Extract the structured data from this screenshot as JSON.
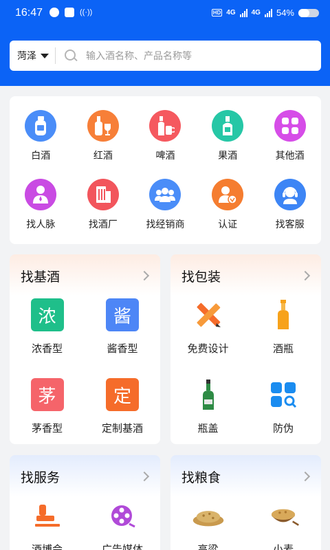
{
  "status_bar": {
    "time": "16:47",
    "network1": "4G",
    "network2": "4G",
    "battery": "54%",
    "hd": "HD"
  },
  "search": {
    "city": "菏泽",
    "placeholder": "输入酒名称、产品名称等"
  },
  "categories": [
    {
      "label": "白酒",
      "icon": "baijiu-bottle-icon",
      "color": "#4a8df8"
    },
    {
      "label": "红酒",
      "icon": "wine-bottle-glass-icon",
      "color": "#f77f38"
    },
    {
      "label": "啤酒",
      "icon": "beer-bottle-mug-icon",
      "color": "#f5595f"
    },
    {
      "label": "果酒",
      "icon": "fruit-wine-bottle-icon",
      "color": "#26c7a6"
    },
    {
      "label": "其他酒",
      "icon": "grid-apps-icon",
      "color": "#d64de8"
    },
    {
      "label": "找人脉",
      "icon": "person-contact-icon",
      "color": "#c94be3"
    },
    {
      "label": "找酒厂",
      "icon": "factory-building-icon",
      "color": "#f2555c"
    },
    {
      "label": "找经销商",
      "icon": "dealers-group-icon",
      "color": "#4a8df8"
    },
    {
      "label": "认证",
      "icon": "certified-user-icon",
      "color": "#f57d30"
    },
    {
      "label": "找客服",
      "icon": "customer-service-headset-icon",
      "color": "#3d85f5"
    }
  ],
  "sections": {
    "base_liquor": {
      "title": "找基酒",
      "items": [
        {
          "label": "浓香型",
          "glyph": "浓",
          "color": "#1fbf8a"
        },
        {
          "label": "酱香型",
          "glyph": "酱",
          "color": "#4d86f6"
        },
        {
          "label": "茅香型",
          "glyph": "茅",
          "color": "#f5646a"
        },
        {
          "label": "定制基酒",
          "glyph": "定",
          "color": "#f56c2a"
        }
      ]
    },
    "packaging": {
      "title": "找包装",
      "items": [
        {
          "label": "免费设计",
          "icon": "ruler-pencil-design-icon"
        },
        {
          "label": "酒瓶",
          "icon": "bottle-icon"
        },
        {
          "label": "瓶盖",
          "icon": "green-bottle-cap-icon"
        },
        {
          "label": "防伪",
          "icon": "anti-counterfeit-search-icon"
        }
      ]
    },
    "services": {
      "title": "找服务",
      "items": [
        {
          "label": "酒博会",
          "icon": "stamp-expo-icon"
        },
        {
          "label": "广告媒体",
          "icon": "film-reel-icon"
        }
      ]
    },
    "grain": {
      "title": "找粮食",
      "items": [
        {
          "label": "高粱",
          "icon": "sorghum-grain-icon"
        },
        {
          "label": "小麦",
          "icon": "wheat-grain-icon"
        }
      ]
    }
  }
}
